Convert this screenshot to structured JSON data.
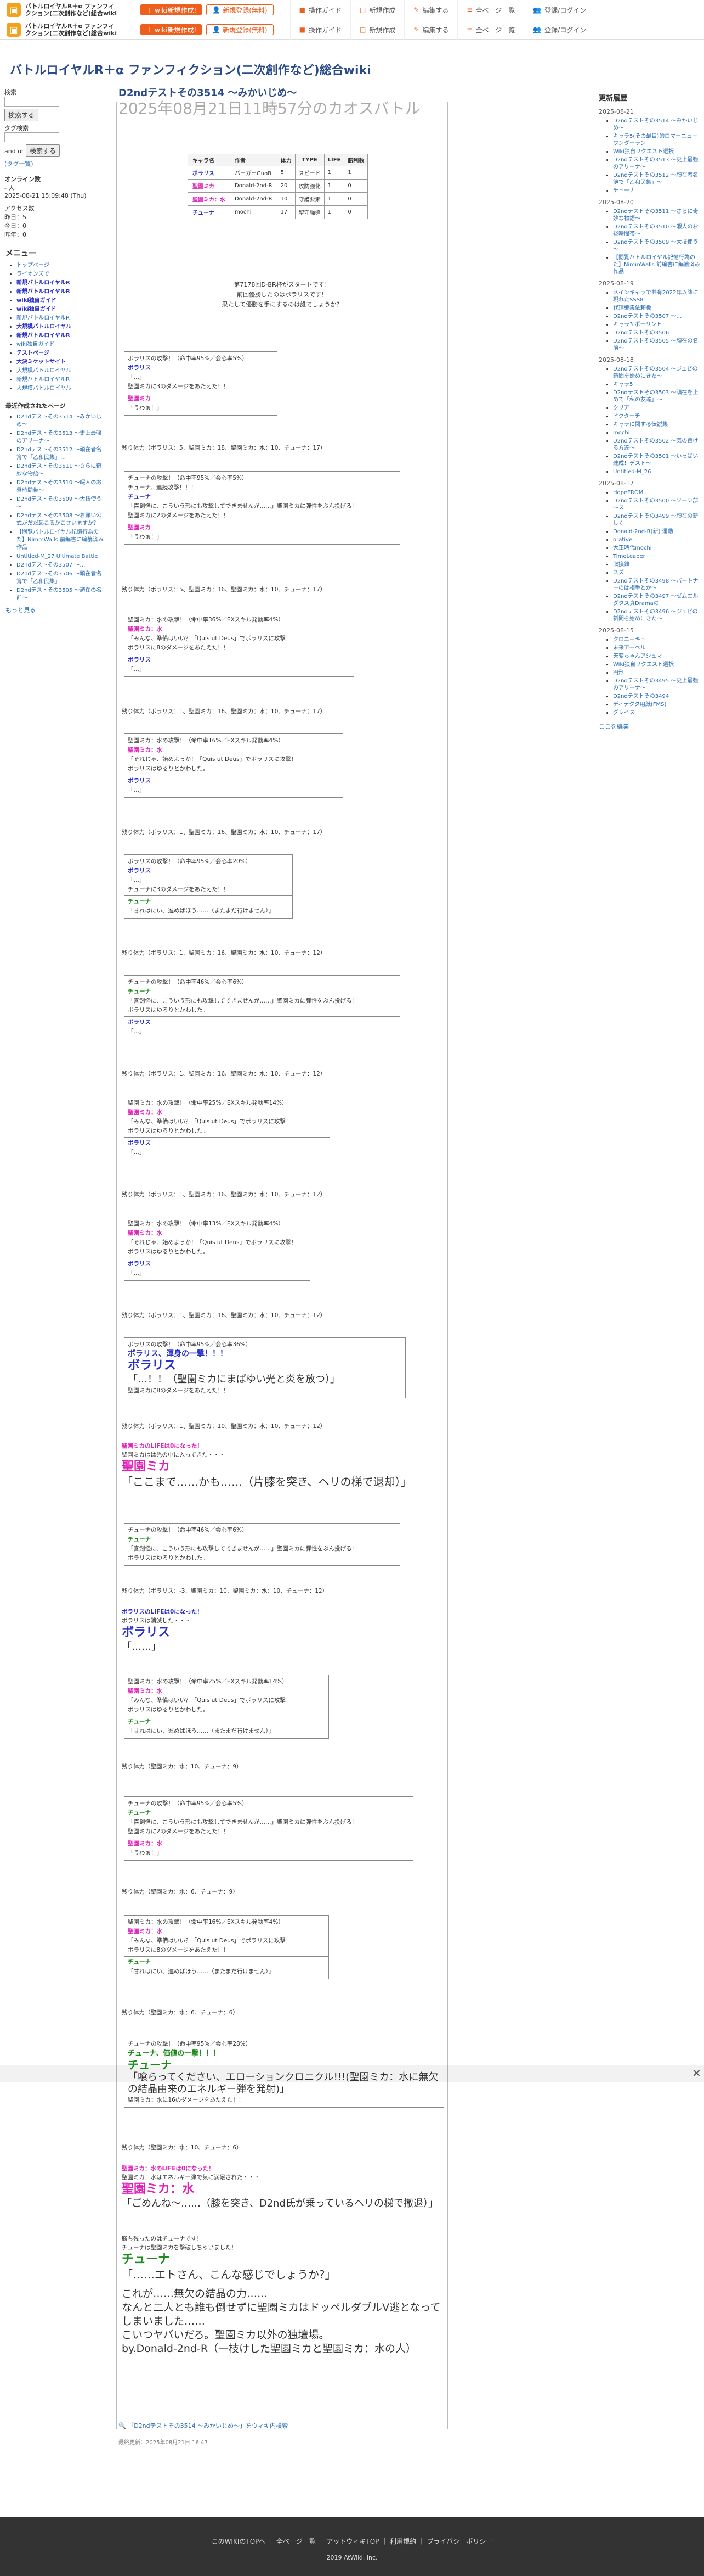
{
  "top_sites": [
    {
      "name": "バトルロイヤルR＋α ファンフィクション(二次創作など)総合wiki",
      "b1": "wiki新規作成!",
      "b2": "新規登録(無料)",
      "menu": [
        "操作ガイド",
        "新規作成",
        "編集する",
        "全ページ一覧",
        "登録/ログイン"
      ]
    },
    {
      "name": "バトルロイヤルR＋α ファンフィクション(二次創作など)総合wiki",
      "b1": "wiki新規作成!",
      "b2": "新規登録(無料)",
      "menu": [
        "操作ガイド",
        "新規作成",
        "編集する",
        "全ページ一覧",
        "登録/ログイン"
      ]
    }
  ],
  "wiki_title": "バトルロイヤルR＋α ファンフィクション(二次創作など)総合wiki",
  "page_title": "D2ndテストその3514 ～みかいじめ～",
  "page_subtitle": "2025年08月21日11時57分のカオスバトル",
  "left": {
    "search_label": "検索",
    "search_btn": "検索する",
    "tag_label": "タグ検索",
    "and_or": "and  or",
    "search_btn2": "検索する",
    "tag_list": "(タグ一覧)",
    "online_title": "オンライン数",
    "online_lines": [
      "- 人",
      "2025-08-21 15:09:48 (Thu)"
    ],
    "access_lines": [
      "アクセス数",
      "昨日：5",
      "今日：0",
      "昨年：0"
    ],
    "menu_title": "メニュー",
    "menu_items": [
      "トップページ",
      "ライオンズで",
      "新規バトルロイヤルR",
      "新規バトルロイヤルR",
      "wiki独自ガイド",
      "wiki独自ガイド",
      "新規バトルロイヤルR",
      "大規模バトルロイヤル",
      "新規バトルロイヤルR",
      "wiki独自ガイド",
      "テストページ",
      "大決ミケットサイト",
      "大規模バトルロイヤル",
      "新規バトルロイヤルR",
      "大規模バトルロイヤル"
    ],
    "recent_title": "最近作成されたページ",
    "recent_items": [
      "D2ndテストその3514 ～みかいじめ～",
      "D2ndテストその3513 ～史上最強のアリーナ～",
      "D2ndテストその3512 ～頑在者名簿で「乙和民集」…",
      "D2ndテストその3511 ～さらに奇妙な物語～",
      "D2ndテストその3510 ～暇人のお昼時間帯～",
      "D2ndテストその3509 ～大技使う～",
      "D2ndテストその3508 ～お願い公式がだだ起こるかこさいますか？",
      "【閲覧バトルロイヤル記憶行為のた】NimmWalls 前編書に編纂済み作品",
      "Untitled-M_27 Ultimate Battle",
      "D2ndテストその3507 ～…",
      "D2ndテストその3506 ～頑在者名簿で「乙和民集」",
      "D2ndテストその3505 ～頑在の名前～"
    ],
    "more": "もっと見る"
  },
  "char_table": {
    "headers": [
      "キャラ名",
      "作者",
      "体力",
      "TYPE",
      "LIFE",
      "勝利数"
    ],
    "rows": [
      [
        "ボラリス",
        "バーガーGuoB",
        "5",
        "スピード",
        "1",
        "1"
      ],
      [
        "聖園ミカ",
        "Donald-2nd-R",
        "20",
        "攻防強化",
        "1",
        "0"
      ],
      [
        "聖園ミカ：水",
        "Donald-2nd-R",
        "10",
        "守護要素",
        "1",
        "0"
      ],
      [
        "チューナ",
        "mochi",
        "17",
        "聖守強導",
        "1",
        "0"
      ]
    ]
  },
  "intro": [
    "第7178回D-BR杯がスタートです！",
    "前回優勝したのはボラリスです！",
    "果たして優勝を手にするのは誰でしょうか？"
  ],
  "logs": [
    {
      "top": "ボラリスの攻撃！（命中率95%／会心率5%）",
      "l2": "ボラリス",
      "l3": "「…」",
      "l4": "聖園ミカに3のダメージをあたえた！！",
      "bot1": "聖園ミカ",
      "bot2": "「うわぁ！」"
    },
    {
      "top": "チューナの攻撃！（命中率95%／会心率5%）",
      "l2": "チューナ、連続攻撃！！！",
      "l3": "チューナ",
      "l4": "「喜剣怪に、こういう形にも攻撃してできませんが……」聖園ミカに弾性をぶん投げる!",
      "l5": "聖園ミカに2のダメージをあたえた！！",
      "bot1": "聖園ミカ",
      "bot2": "「うわぁ！」"
    },
    {
      "top": "聖園ミカ：水の攻撃！（命中率36%／EXスキル発動率4%）",
      "l2": "聖園ミカ：水",
      "l3": "「みんな、準備はいい？「Quis ut Deus」でボラリスに攻撃！",
      "l4": "ボラリスに8のダメージをあたえた！！",
      "bot1": "ボラリス",
      "bot2": "「…」"
    },
    {
      "top": "聖園ミカ：水の攻撃！（命中率16%／EXスキル発動率4%）",
      "l2": "聖園ミカ：水",
      "l3": "「それじゃ、始めよっか！「Quis ut Deus」でボラリスに攻撃！",
      "l4": "ボラリスはゆるりとかわした。",
      "bot1": "ボラリス",
      "bot2": "「…」"
    },
    {
      "top": "ボラリスの攻撃！（命中率95%／会心率20%）",
      "l2": "ボラリス",
      "l3": "「…」",
      "l4": "チューナに3のダメージをあたえた！！",
      "bot1": "チューナ",
      "bot2": "「甘れはにい、進めばほう……（またまだ行けません）」"
    },
    {
      "top": "チューナの攻撃！（命中率46%／会心率6%）",
      "l2": "チューナ",
      "l3": "「喜剣怪に、こういう形にも攻撃してできませんが……」聖園ミカに弾性をぶん投げる!",
      "l4": "ボラリスはゆるりとかわした。",
      "bot1": "ボラリス",
      "bot2": "「…」"
    },
    {
      "top": "聖園ミカ：水の攻撃！（命中率25%／EXスキル発動率14%）",
      "l2": "聖園ミカ：水",
      "l3": "「みんな、準備はいい？「Quis ut Deus」でボラリスに攻撃！",
      "l4": "ボラリスはゆるりとかわした。",
      "bot1": "ボラリス",
      "bot2": "「…」"
    },
    {
      "top": "聖園ミカ：水の攻撃！（命中率13%／EXスキル発動率4%）",
      "l2": "聖園ミカ：水",
      "l3": "「それじゃ、始めよっか！「Quis ut Deus」でボラリスに攻撃！",
      "l4": "ボラリスはゆるりとかわした。",
      "bot1": "ボラリス",
      "bot2": "「…」"
    }
  ],
  "hps": [
    "残り体力（ボラリス：5、聖園ミカ：18、聖園ミカ：水：10、チューナ：17）",
    "残り体力（ボラリス：5、聖園ミカ：16、聖園ミカ：水：10、チューナ：17）",
    "残り体力（ボラリス：1、聖園ミカ：16、聖園ミカ：水：10、チューナ：17）",
    "残り体力（ボラリス：1、聖園ミカ：16、聖園ミカ：水：10、チューナ：17）",
    "残り体力（ボラリス：1、聖園ミカ：16、聖園ミカ：水：10、チューナ：12）",
    "残り体力（ボラリス：1、聖園ミカ：16、聖園ミカ：水：10、チューナ：12）",
    "残り体力（ボラリス：1、聖園ミカ：16、聖園ミカ：水：10、チューナ：12）",
    "残り体力（ボラリス：1、聖園ミカ：16、聖園ミカ：水：10、チューナ：12）",
    "残り体力（ボラリス：1、聖園ミカ：10、聖園ミカ：水：10、チューナ：12）",
    "残り体力（ボラリス：-3、聖園ミカ：10、聖園ミカ：水：10、チューナ：12）",
    "残り体力（聖園ミカ：水：10、チューナ：9）",
    "残り体力（聖園ミカ：水：6、チューナ：9）",
    "残り体力（聖園ミカ：水：6、チューナ：6）",
    "残り体力（聖園ミカ：水：10、チューナ：6）"
  ],
  "big_ex": {
    "top": "ボラリスの攻撃！（命中率95%／会心率36%）",
    "l2": "ボラリス、渾身の一撃！！！",
    "name": "ボラリス",
    "quote": "「…！！（聖園ミカにまばゆい光と炎を放つ）」",
    "dmg": "聖園ミカに8のダメージをあたえた！！"
  },
  "mika_line": {
    "pre1": "聖園ミカのLIFEは0になった！",
    "pre2": "聖園ミカはは光の中に入ってきた・・・",
    "name": "聖園ミカ",
    "quote": "「ここまで……かも……（片膝を突き、ヘリの梯で退却）」"
  },
  "polaris_line": {
    "pre1": "ボラリスのLIFEは0になった！",
    "pre2": "ボラリスは消滅した・・・",
    "name": "ボラリス",
    "quote": "「……」"
  },
  "chuna_ex": {
    "top": "チューナの攻撃！（命中率95%／会心率28%）",
    "l2": "チューナ、価値の一撃！！！",
    "name": "チューナ",
    "quote": "「喰らってください、エローションクロニクル!!!(聖園ミカ：水に無欠の結晶由来のエネルギー弾を発射)」",
    "dmg": "聖園ミカ：水に16のダメージをあたえた！！"
  },
  "mika_water_line": {
    "pre1": "聖園ミカ：水のLIFEは0になった！",
    "pre2": "聖園ミカ：水はエネルギー弾で気に満足された・・・",
    "name": "聖園ミカ：水",
    "quote": "「ごめんね〜……（膝を突き、D2nd氏が乗っているヘリの梯で撤退）」"
  },
  "winner": {
    "pre1": "勝ち残ったのはチューナです！",
    "pre2": "チューナは聖園ミカを撃破しちゃいました！",
    "name": "チューナ",
    "quote": "「……エトさん、こんな感じでしょうか?」"
  },
  "afterword": [
    "これが……無欠の結晶の力……",
    "なんと二人とも誰も倒せずに聖園ミカはドッペルダブルV逃となってしまいました……",
    "こいつヤバいだろ。聖園ミカ以外の独壇場。",
    "by.Donald-2nd-R（一枝けした聖園ミカと聖園ミカ：水の人）"
  ],
  "search_footer": "「D2ndテストその3514 ～みかいじめ～」をウィキ内検索",
  "last_update": "最終更新：2025年08月21日 16:47",
  "right": {
    "title": "更新履歴",
    "groups": [
      {
        "date": "2025-08-21",
        "items": [
          "D2ndテストその3514 ～みかいじめ～",
          "キャラ5(その最目)的ロマーニュ－ワンダーラン",
          "Wiki独自リクエスト選択",
          "D2ndテストその3513 ～史上最強のアリーナ～",
          "D2ndテストその3512 ～頑在者名簿で「乙和民集」～",
          "チューナ"
        ]
      },
      {
        "date": "2025-08-20",
        "items": [
          "D2ndテストその3511 ～さらに奇妙な物語～",
          "D2ndテストその3510 ～暇人のお昼時間帯～",
          "D2ndテストその3509 ～大技使う～",
          "【閲覧バトルロイヤル記憶行為のた】NimmWalls 前編書に編纂済み作品"
        ]
      },
      {
        "date": "2025-08-19",
        "items": [
          "メインキャラで共有2022年以降に現れたSSS8",
          "代理編集依頼板",
          "D2ndテストその3507 ～…",
          "キャラ3 ポーリント",
          "D2ndテストその3506",
          "D2ndテストその3505 ～頑在の名前～"
        ]
      },
      {
        "date": "2025-08-18",
        "items": [
          "D2ndテストその3504 ～ジュピの新聞を始めにきた～",
          "キャラ5",
          "D2ndテストその3503 ～頑在を止めて「私の友達」～",
          "クリア",
          "ドクターチ",
          "キャラに関する伝説集",
          "mochi",
          "D2ndテストその3502 ～気の置ける方達～",
          "D2ndテストその3501 ～いっぱい達成！デスト～",
          "Untitled-M_26"
        ]
      },
      {
        "date": "2025-08-17",
        "items": [
          "HopeFROM",
          "D2ndテストその3500 ～ソーシ部～ス",
          "D2ndテストその3499 ～頑在の新しく",
          "Donald-2nd-R(新) 運動",
          "orative",
          "大正時代mochi",
          "TimeLeaper",
          "取換錐",
          "スズ",
          "D2ndテストその3498 ～パートナーのは相手とか～",
          "D2ndテストその3497 ～ゼムエルダタス真Dramaの",
          "D2ndテストその3496 ～ジュピの新聞を始めにきた～"
        ]
      },
      {
        "date": "2025-08-15",
        "items": [
          "クロニーキュ",
          "未来アーベル",
          "天変ちゃんアシュマ",
          "Wiki独自リクエスト選択",
          "円形",
          "D2ndテストその3495 ～史上最強のアリーナ～",
          "D2ndテストその3494",
          "ディテクタ用紙(FMS)",
          "グレイス"
        ]
      }
    ],
    "more": "ここを編集"
  },
  "footer": {
    "links": "このWIKIのTOPへ ｜ 全ページ一覧 ｜ アットウィキTOP ｜ 利用規約 ｜ プライバシーポリシー",
    "copy": "2019 AtWiki, Inc."
  },
  "colors": {
    "accent": "#ee5e1d",
    "link": "#2a6cb2",
    "magenta": "#e020b8",
    "blue": "#2a30c8",
    "green": "#1b8a1b"
  }
}
